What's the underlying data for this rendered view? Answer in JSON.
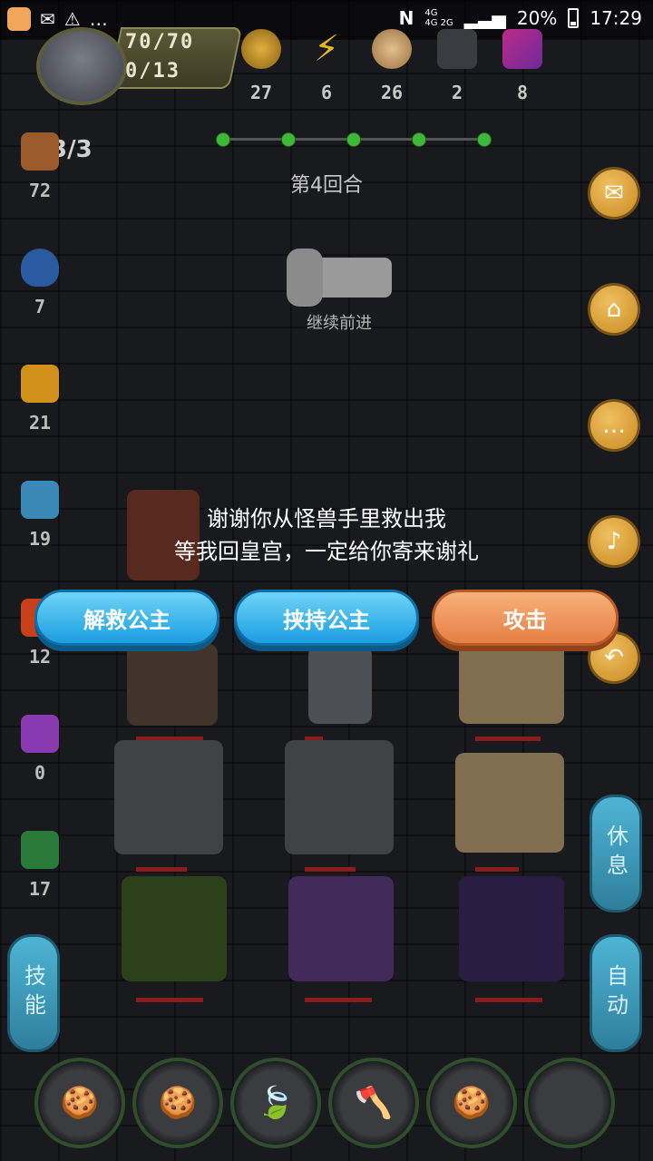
{
  "status_bar": {
    "network_top": "4G",
    "network_bottom": "4G 2G",
    "battery": "20%",
    "time": "17:29"
  },
  "player": {
    "hp": "70/70",
    "exp": "0/13"
  },
  "resources": [
    {
      "icon": "coin-icon",
      "value": "27"
    },
    {
      "icon": "lightning-icon",
      "value": "6"
    },
    {
      "icon": "bread-icon",
      "value": "26"
    },
    {
      "icon": "ore-icon",
      "value": "2"
    },
    {
      "icon": "crystal-icon",
      "value": "8"
    }
  ],
  "round": {
    "label": "第4回合",
    "proceed": "继续前进"
  },
  "left_stats": {
    "fist_count": "3/3",
    "items": [
      {
        "icon": "fist-icon",
        "value": "72"
      },
      {
        "icon": "shield-icon",
        "value": "7"
      },
      {
        "icon": "flame-icon",
        "value": "21"
      },
      {
        "icon": "wave-icon",
        "value": "19"
      },
      {
        "icon": "fire-icon",
        "value": "12"
      },
      {
        "icon": "lightning-purple-icon",
        "value": "0"
      },
      {
        "icon": "plant-icon",
        "value": "17"
      }
    ]
  },
  "side_buttons": {
    "rest": "休息",
    "auto": "自动",
    "skill": "技能"
  },
  "dialog": {
    "line1": "谢谢你从怪兽手里救出我",
    "line2": "等我回皇宫，一定给你寄来谢礼"
  },
  "choices": {
    "rescue": "解救公主",
    "kidnap": "挟持公主",
    "attack": "攻击"
  },
  "colors": {
    "choice_blue": "#1b9ee0",
    "choice_orange": "#e67f45",
    "side_gold": "#c88a22",
    "hp_red": "#c0282a"
  }
}
